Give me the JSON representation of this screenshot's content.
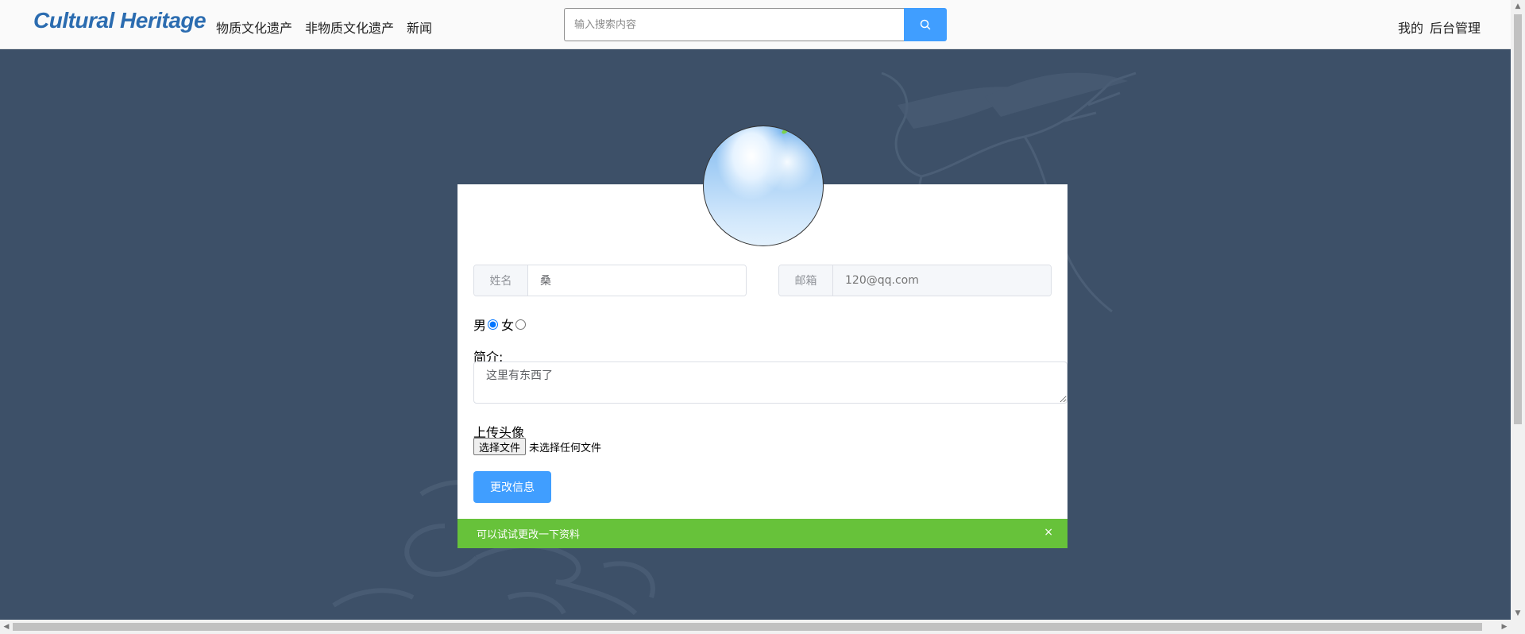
{
  "header": {
    "logo": "Cultural Heritage",
    "nav": [
      "物质文化遗产",
      "非物质文化遗产",
      "新闻"
    ],
    "search": {
      "placeholder": "输入搜索内容",
      "value": ""
    },
    "user_links": [
      "我的",
      "后台管理"
    ]
  },
  "profile": {
    "name_label": "姓名",
    "name_value": "桑",
    "email_label": "邮箱",
    "email_placeholder": "120@qq.com",
    "gender": {
      "male": "男",
      "female": "女",
      "selected": "male"
    },
    "intro_label": "简介:",
    "intro_value": "这里有东西了",
    "upload_label": "上传头像",
    "file_button": "选择文件",
    "file_status": "未选择任何文件",
    "submit_label": "更改信息"
  },
  "alert": {
    "text": "可以试试更改一下资料",
    "close": "×",
    "color": "#67c23a"
  },
  "colors": {
    "accent": "#409eff",
    "background": "#3d5068",
    "logo": "#2b6cb0"
  }
}
